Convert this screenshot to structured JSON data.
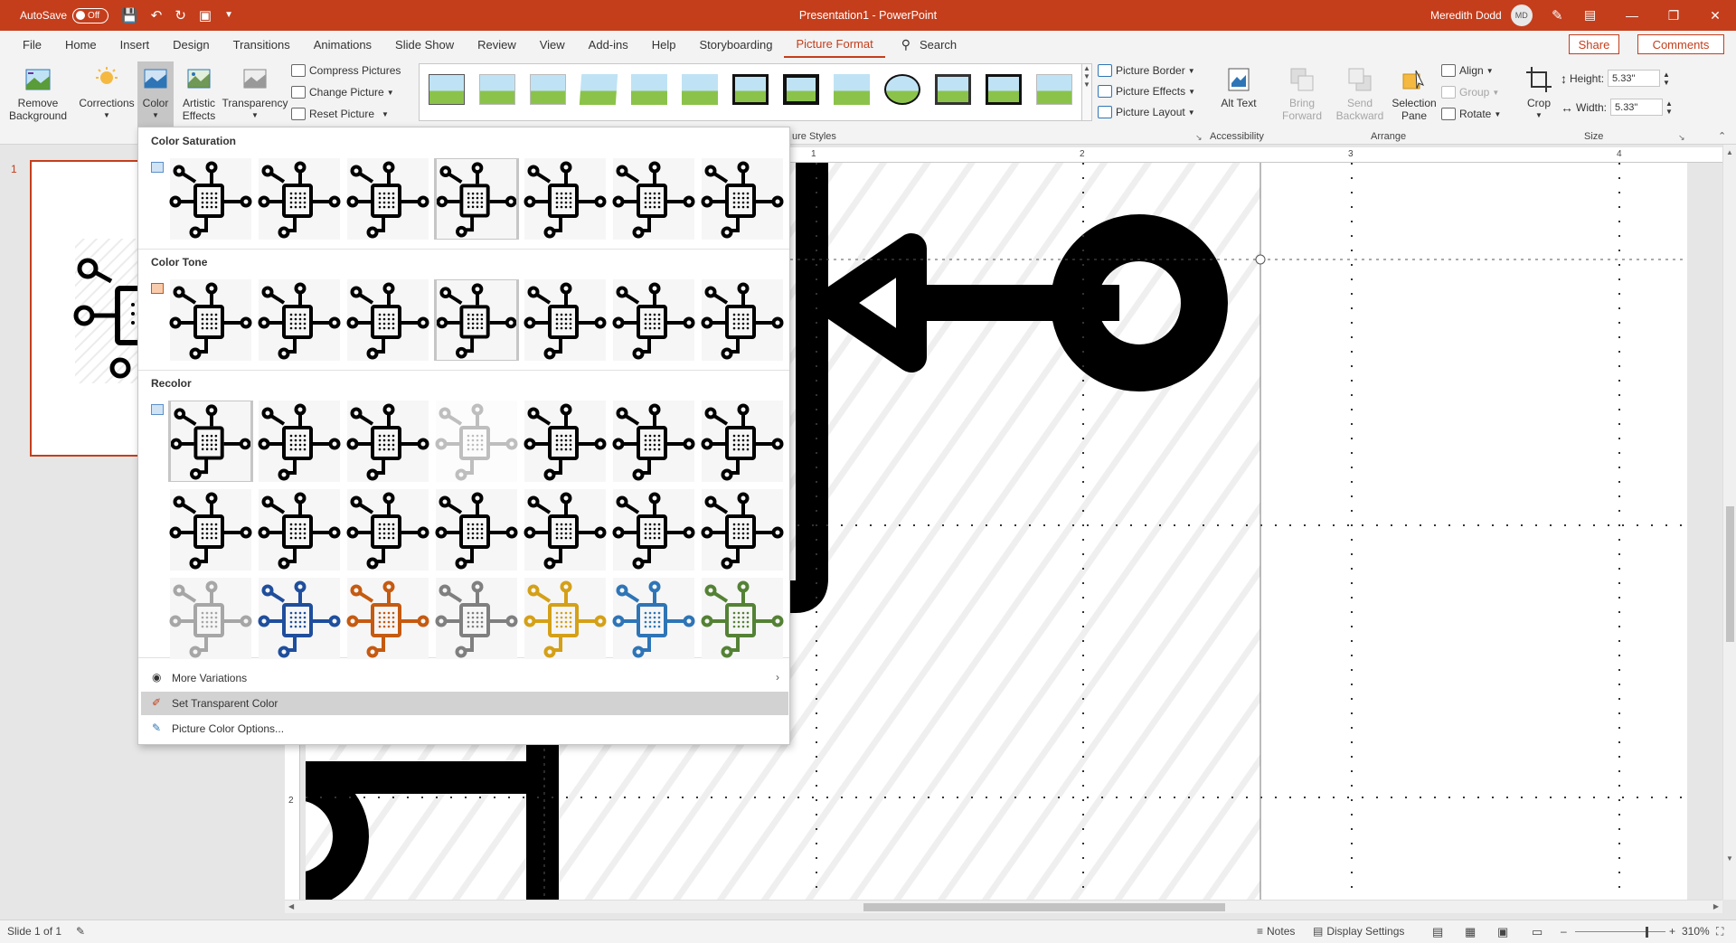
{
  "titlebar": {
    "autosave_label": "AutoSave",
    "autosave_state": "Off",
    "document_title": "Presentation1  -  PowerPoint",
    "user_name": "Meredith Dodd",
    "user_initials": "MD"
  },
  "tabs": [
    "File",
    "Home",
    "Insert",
    "Design",
    "Transitions",
    "Animations",
    "Slide Show",
    "Review",
    "View",
    "Add-ins",
    "Help",
    "Storyboarding",
    "Picture Format"
  ],
  "active_tab": "Picture Format",
  "search_label": "Search",
  "share_label": "Share",
  "comments_label": "Comments",
  "ribbon": {
    "remove_background": "Remove Background",
    "corrections": "Corrections",
    "color": "Color",
    "artistic_effects": "Artistic Effects",
    "transparency": "Transparency",
    "compress_pictures": "Compress Pictures",
    "change_picture": "Change Picture",
    "reset_picture": "Reset Picture",
    "picture_border": "Picture Border",
    "picture_effects": "Picture Effects",
    "picture_layout": "Picture Layout",
    "alt_text": "Alt Text",
    "bring_forward": "Bring Forward",
    "send_backward": "Send Backward",
    "selection_pane": "Selection Pane",
    "align": "Align",
    "group": "Group",
    "rotate": "Rotate",
    "crop": "Crop",
    "height_label": "Height:",
    "height_value": "5.33\"",
    "width_label": "Width:",
    "width_value": "5.33\"",
    "group_labels": {
      "picture_styles": "ure Styles",
      "accessibility": "Accessibility",
      "arrange": "Arrange",
      "size": "Size"
    }
  },
  "color_menu": {
    "color_saturation": "Color Saturation",
    "color_tone": "Color Tone",
    "recolor": "Recolor",
    "more_variations": "More Variations",
    "set_transparent_color": "Set Transparent Color",
    "picture_color_options": "Picture Color Options...",
    "recolor_colors": [
      "#a6a6a6",
      "#1f4e9c",
      "#c55a11",
      "#7f7f7f",
      "#d4a017",
      "#2e75b6",
      "#548235"
    ]
  },
  "thumbnail": {
    "slide_number": "1"
  },
  "rulers": {
    "horizontal": [
      "1",
      "2",
      "3",
      "4"
    ],
    "vertical": [
      "2"
    ]
  },
  "status": {
    "slide_count": "Slide 1 of 1",
    "notes": "Notes",
    "display_settings": "Display Settings",
    "zoom": "310%"
  }
}
